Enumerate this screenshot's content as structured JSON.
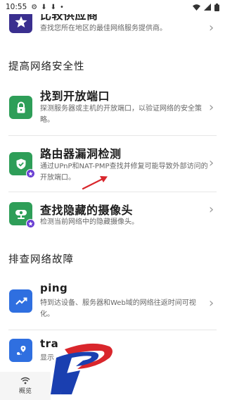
{
  "status_bar": {
    "time": "10:55",
    "extra_glyphs": [
      "⚙",
      "⬇",
      "⬇",
      "•"
    ]
  },
  "items": [
    {
      "title": "比较供应商",
      "desc": "查找您所在地区的最佳网络服务提供商。",
      "icon": "star-icon",
      "color": "#3a2f8f"
    },
    {
      "title": "找到开放端口",
      "desc": "探测服务器或主机的开放端口，以验证网络的安全策略。",
      "icon": "lock-icon",
      "color": "#2e9e58"
    },
    {
      "title": "路由器漏洞检测",
      "desc": "通过UPnP和NAT-PMP查找并修复可能导致外部访问的开放端口。",
      "icon": "shield-icon",
      "color": "#2e9e58"
    },
    {
      "title": "查找隐藏的摄像头",
      "desc": "检测当前网络中的隐藏摄像头。",
      "icon": "camera-icon",
      "color": "#2e9e58"
    },
    {
      "title": "ping",
      "desc": "特到达设备、服务器和Web域的网络往返时间可视化。",
      "icon": "trend-icon",
      "color": "#2f6fe0"
    },
    {
      "title": "tra",
      "desc": "显示",
      "icon": "route-icon",
      "color": "#2f6fe0"
    }
  ],
  "sections": {
    "security": "提高网络安全性",
    "troubleshoot": "排查网络故障"
  },
  "bottom_nav": {
    "overview_label": "概览",
    "icon": "wifi-icon"
  },
  "colors": {
    "green": "#2e9e58",
    "blue": "#2f6fe0",
    "purple": "#3a2f8f",
    "badge": "#6a3fd3",
    "watermark_blue": "#1a3fb0",
    "watermark_red": "#d9262c"
  }
}
